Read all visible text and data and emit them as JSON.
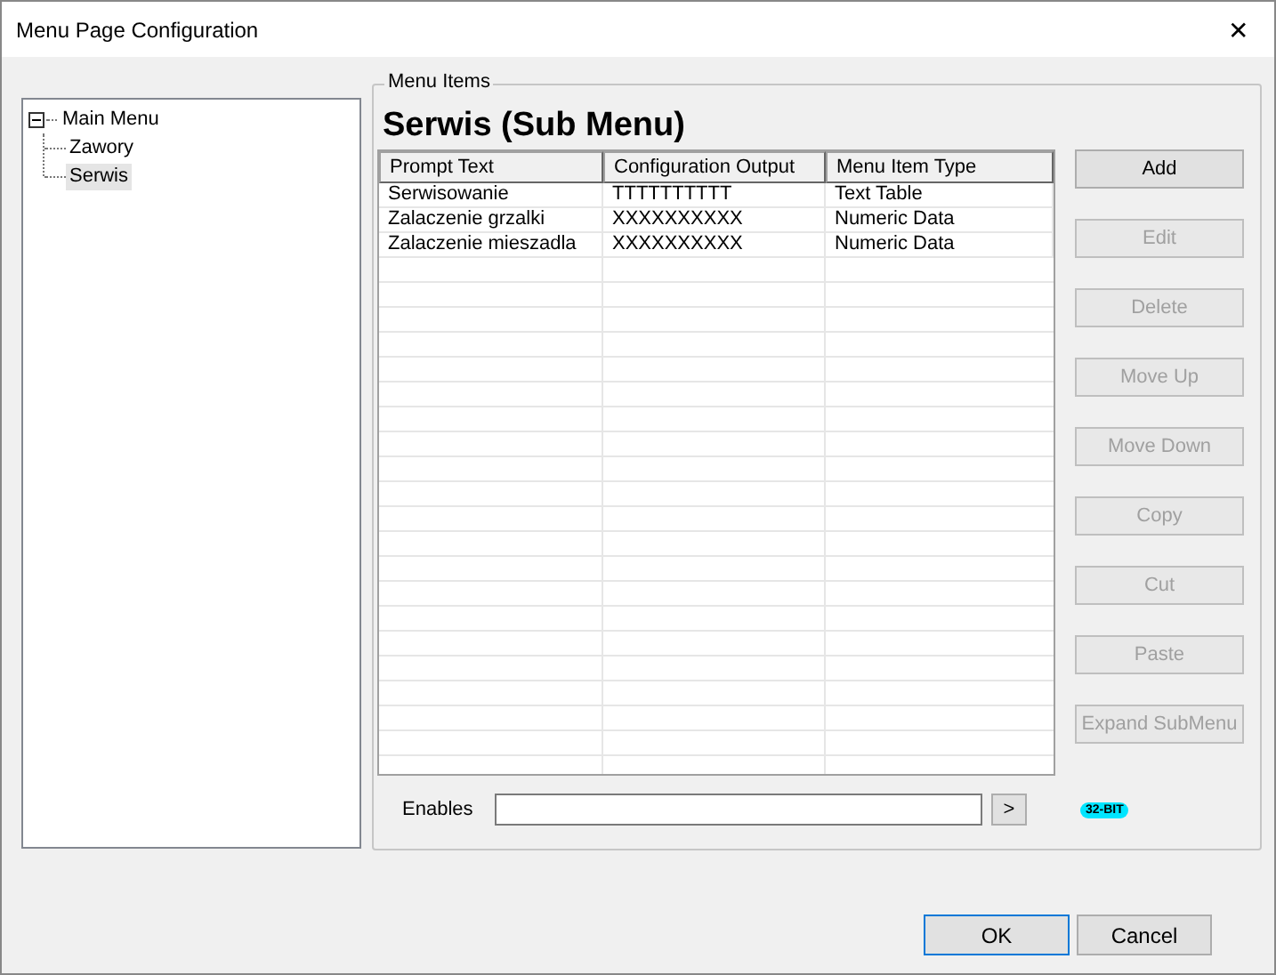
{
  "window": {
    "title": "Menu Page Configuration",
    "close": "✕"
  },
  "tree": {
    "items": [
      {
        "label": "Main Menu",
        "expanded": true,
        "selected": false,
        "children": [
          {
            "label": "Zawory",
            "selected": false
          },
          {
            "label": "Serwis",
            "selected": true
          }
        ]
      }
    ]
  },
  "group": {
    "legend": "Menu Items",
    "heading": "Serwis (Sub Menu)"
  },
  "table": {
    "columns": [
      "Prompt Text",
      "Configuration Output",
      "Menu Item Type"
    ],
    "rows": [
      [
        "Serwisowanie",
        "TTTTTTTTTT",
        "Text Table"
      ],
      [
        "Zalaczenie grzalki",
        "XXXXXXXXXX",
        "Numeric Data"
      ],
      [
        "Zalaczenie mieszadla",
        "XXXXXXXXXX",
        "Numeric Data"
      ]
    ]
  },
  "actions": [
    {
      "label": "Add",
      "disabled": false
    },
    {
      "label": "Edit",
      "disabled": true
    },
    {
      "label": "Delete",
      "disabled": true
    },
    {
      "label": "Move Up",
      "disabled": true
    },
    {
      "label": "Move Down",
      "disabled": true
    },
    {
      "label": "Copy",
      "disabled": true
    },
    {
      "label": "Cut",
      "disabled": true
    },
    {
      "label": "Paste",
      "disabled": true
    },
    {
      "label": "Expand SubMenu",
      "disabled": true
    }
  ],
  "enables": {
    "label": "Enables",
    "button": ">",
    "badge": "32-BIT"
  },
  "buttons": [
    "OK",
    "Cancel"
  ]
}
